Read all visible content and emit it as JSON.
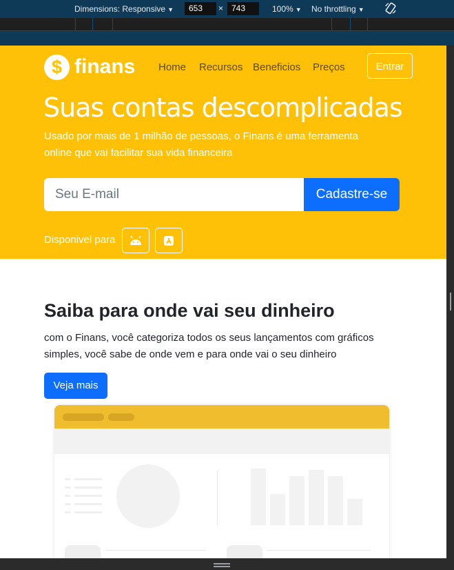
{
  "devtools": {
    "dimensions_label": "Dimensions: Responsive",
    "width": "653",
    "times": "×",
    "height": "743",
    "zoom": "100%",
    "throttling": "No throttling",
    "dropdown_glyph": "▼"
  },
  "header": {
    "logo_symbol": "$",
    "logo_text": "finans",
    "nav": [
      "Home",
      "Recursos",
      "Beneficios",
      "Preços"
    ],
    "login_label": "Entrar"
  },
  "hero": {
    "title": "Suas contas descomplicadas",
    "subtitle": "Usado por mais de 1 milhão de pessoas, o Finans é uma ferramenta online que vai facilitar sua vida financeira",
    "email_placeholder": "Seu E-mail",
    "signup_label": "Cadastre-se",
    "available_label": "Disponivel para",
    "stores": [
      "android-icon",
      "app-store-icon"
    ]
  },
  "section": {
    "title": "Saiba para onde vai seu dinheiro",
    "text": "com o Finans, você categoriza todos os seus lançamentos com gráficos simples, você sabe de onde vem e para onde vai o seu dinheiro",
    "button_label": "Veja mais"
  },
  "colors": {
    "brand_yellow": "#ffc107",
    "primary_blue": "#0d6efd",
    "devtools_bg": "#0e3a57"
  }
}
